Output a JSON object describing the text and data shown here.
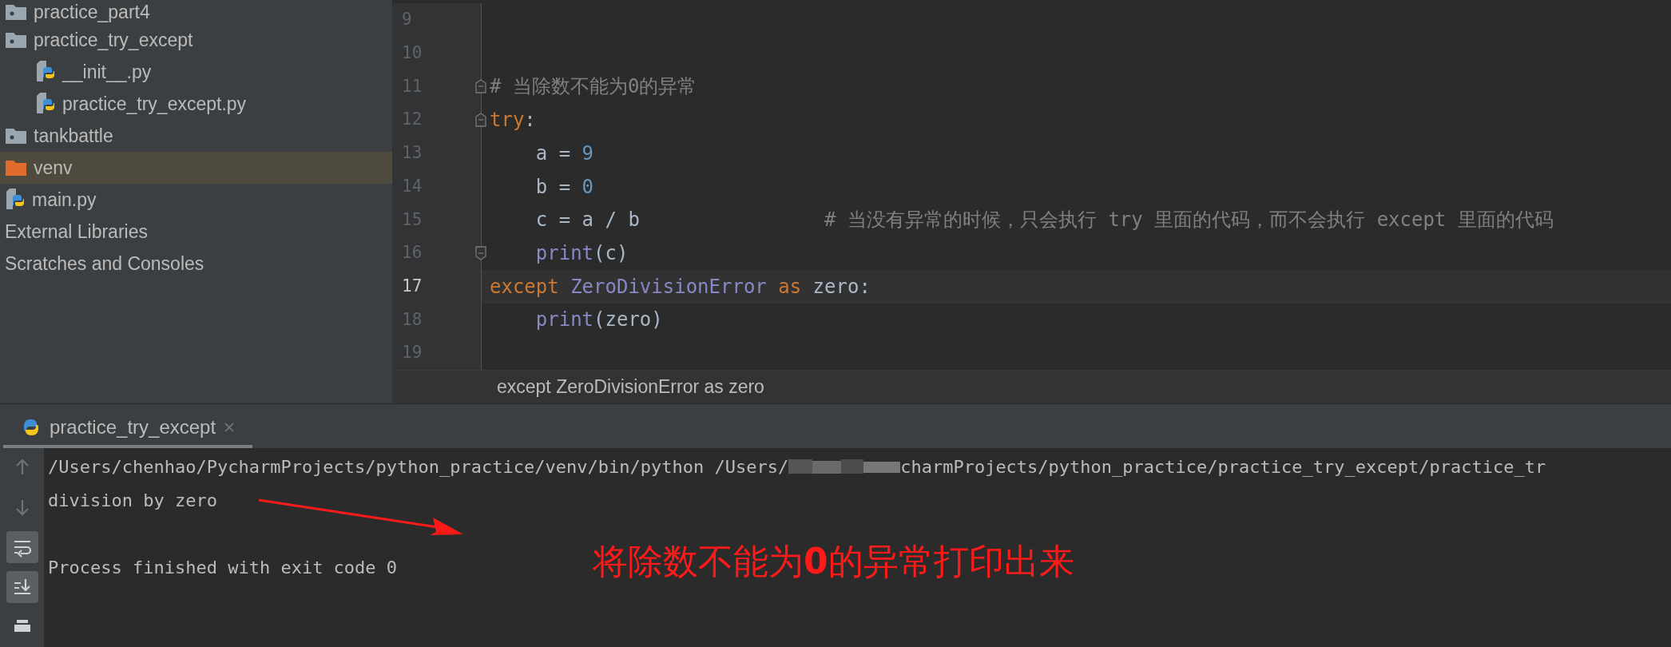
{
  "project_tree": [
    {
      "label": "practice_part4",
      "kind": "package",
      "selected": false
    },
    {
      "label": "practice_try_except",
      "kind": "package",
      "selected": false,
      "children": [
        {
          "label": "__init__.py",
          "kind": "python",
          "selected": false
        },
        {
          "label": "practice_try_except.py",
          "kind": "python",
          "selected": false
        }
      ]
    },
    {
      "label": "tankbattle",
      "kind": "package",
      "selected": false
    },
    {
      "label": "venv",
      "kind": "excluded",
      "selected": true
    },
    {
      "label": "main.py",
      "kind": "python",
      "selected": false
    },
    {
      "label": "External Libraries",
      "kind": "plain",
      "selected": false
    },
    {
      "label": "Scratches and Consoles",
      "kind": "plain",
      "selected": false
    }
  ],
  "editor": {
    "lines": [
      {
        "number": "9",
        "current": false,
        "fold_start": false,
        "fold_end": false
      },
      {
        "number": "10",
        "current": false,
        "fold_start": false,
        "fold_end": false
      },
      {
        "number": "11",
        "current": false,
        "fold_start": true,
        "fold_end": false,
        "tokens": [
          {
            "text": "# 当除数不能为0的异常",
            "kind": "comment"
          }
        ]
      },
      {
        "number": "12",
        "current": false,
        "fold_start": true,
        "fold_end": false,
        "tokens": [
          {
            "text": "try",
            "kind": "keyword"
          },
          {
            "text": ":",
            "kind": "plain"
          }
        ]
      },
      {
        "number": "13",
        "current": false,
        "fold_start": false,
        "fold_end": false,
        "tokens": [
          {
            "text": "    a = ",
            "kind": "plain"
          },
          {
            "text": "9",
            "kind": "number"
          }
        ]
      },
      {
        "number": "14",
        "current": false,
        "fold_start": false,
        "fold_end": false,
        "tokens": [
          {
            "text": "    b = ",
            "kind": "plain"
          },
          {
            "text": "0",
            "kind": "number"
          }
        ]
      },
      {
        "number": "15",
        "current": false,
        "fold_start": false,
        "fold_end": false,
        "tokens": [
          {
            "text": "    c = a / b                ",
            "kind": "plain"
          },
          {
            "text": "# 当没有异常的时候，只会执行 try 里面的代码，而不会执行 except 里面的代码",
            "kind": "comment"
          }
        ]
      },
      {
        "number": "16",
        "current": false,
        "fold_start": false,
        "fold_end": true,
        "tokens": [
          {
            "text": "    print",
            "kind": "builtin"
          },
          {
            "text": "(c)",
            "kind": "plain"
          }
        ]
      },
      {
        "number": "17",
        "current": true,
        "fold_start": false,
        "fold_end": false,
        "tokens": [
          {
            "text": "except ",
            "kind": "keyword"
          },
          {
            "text": "ZeroDivisionError",
            "kind": "builtin"
          },
          {
            "text": " as ",
            "kind": "keyword"
          },
          {
            "text": "zero:",
            "kind": "plain"
          }
        ]
      },
      {
        "number": "18",
        "current": false,
        "fold_start": false,
        "fold_end": false,
        "tokens": [
          {
            "text": "    print",
            "kind": "builtin"
          },
          {
            "text": "(zero)",
            "kind": "plain"
          }
        ]
      },
      {
        "number": "19",
        "current": false,
        "fold_start": false,
        "fold_end": false
      }
    ],
    "breadcrumb": "except ZeroDivisionError as zero"
  },
  "run_panel": {
    "tabs": [
      {
        "label": "practice_try_except",
        "selected": true
      }
    ],
    "toolbar": [
      {
        "kind": "up",
        "on": false
      },
      {
        "kind": "down",
        "on": false
      },
      {
        "kind": "wrap",
        "on": true
      },
      {
        "kind": "scroll-end",
        "on": true
      },
      {
        "kind": "print",
        "on": false
      }
    ],
    "output": [
      {
        "kind": "command",
        "parts": [
          "/Users/chenhao/PycharmProjects/python_practice/venv/bin/python /Users/",
          "charmProjects/python_practice/practice_try_except/practice_tr"
        ]
      },
      {
        "kind": "text",
        "text": "division by zero"
      },
      {
        "kind": "blank"
      },
      {
        "kind": "text",
        "text": "Process finished with exit code 0"
      }
    ]
  },
  "annotation": {
    "text": "将除数不能为**0**的异常打印出来"
  }
}
